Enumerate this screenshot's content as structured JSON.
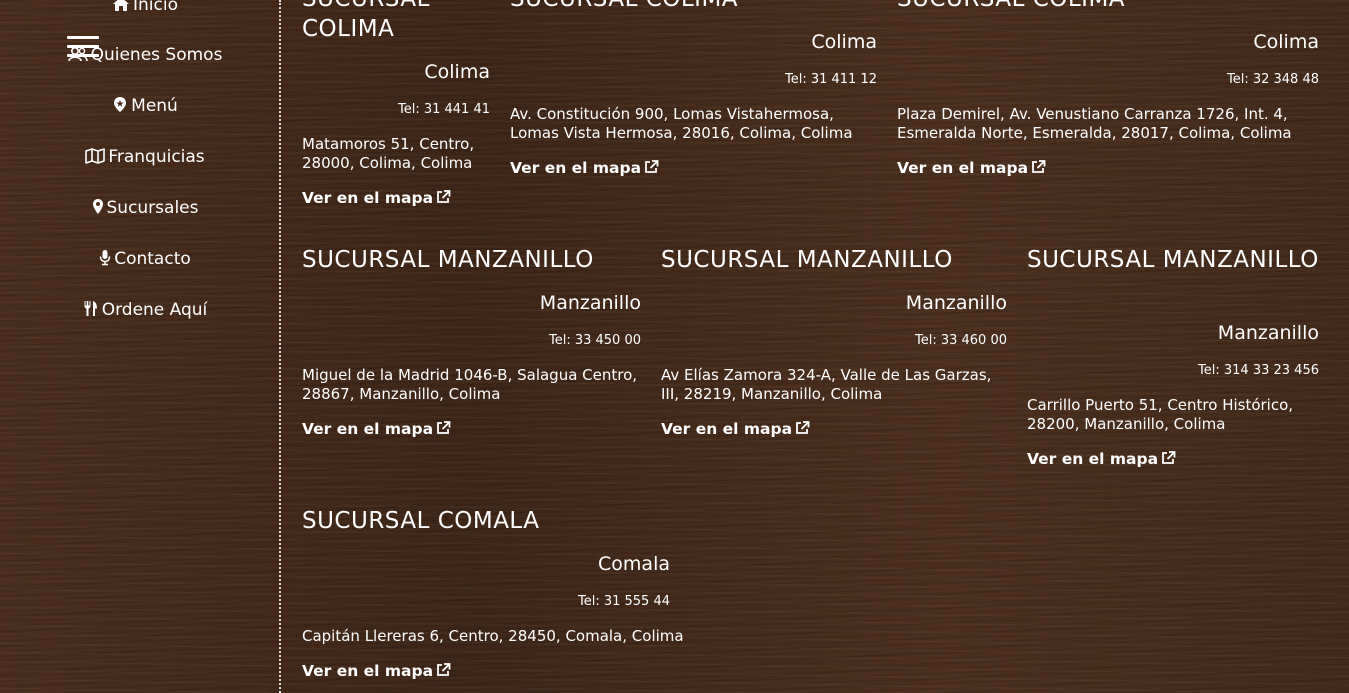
{
  "menu": {
    "items": [
      {
        "label": "Inicio",
        "icon": "home-icon"
      },
      {
        "label": "Quienes Somos",
        "icon": "users-icon"
      },
      {
        "label": "Menú",
        "icon": "map-pin-star-icon"
      },
      {
        "label": "Franquicias",
        "icon": "map-icon"
      },
      {
        "label": "Sucursales",
        "icon": "map-marker-icon"
      },
      {
        "label": "Contacto",
        "icon": "microphone-icon"
      },
      {
        "label": "Ordene Aquí",
        "icon": "utensils-icon"
      }
    ]
  },
  "branches": [
    {
      "title": "SUCURSAL COLIMA",
      "city": "Colima",
      "tel": "Tel: 31 441 41",
      "address": "Matamoros 51, Centro, 28000, Colima, Colima",
      "map_link": "Ver en el mapa"
    },
    {
      "title": "SUCURSAL COLIMA",
      "city": "Colima",
      "tel": "Tel: 31 411 12",
      "address": "Av. Constitución 900, Lomas Vistahermosa, Lomas Vista Hermosa, 28016, Colima, Colima",
      "map_link": "Ver en el mapa"
    },
    {
      "title": "SUCURSAL COLIMA",
      "city": "Colima",
      "tel": "Tel: 32 348 48",
      "address": "Plaza Demirel, Av. Venustiano Carranza 1726, Int. 4, Esmeralda Norte, Esmeralda, 28017, Colima, Colima",
      "map_link": "Ver en el mapa"
    },
    {
      "title": "SUCURSAL MANZANILLO",
      "city": "Manzanillo",
      "tel": "Tel: 33 450 00",
      "address": "Miguel de la Madrid 1046-B, Salagua Centro, 28867, Manzanillo, Colima",
      "map_link": "Ver en el mapa"
    },
    {
      "title": "SUCURSAL MANZANILLO",
      "city": "Manzanillo",
      "tel": "Tel: 33 460 00",
      "address": "Av Elías Zamora 324-A, Valle de Las Garzas, III, 28219, Manzanillo, Colima",
      "map_link": "Ver en el mapa"
    },
    {
      "title": "SUCURSAL MANZANILLO",
      "city": "Manzanillo",
      "tel": "Tel: 314 33 23 456",
      "address": "Carrillo Puerto 51, Centro Histórico, 28200, Manzanillo, Colima",
      "map_link": "Ver en el mapa"
    },
    {
      "title": "SUCURSAL COMALA",
      "city": "Comala",
      "tel": "Tel: 31 555 44",
      "address": "Capitán Llereras 6, Centro, 28450, Comala, Colima",
      "map_link": "Ver en el mapa"
    }
  ]
}
